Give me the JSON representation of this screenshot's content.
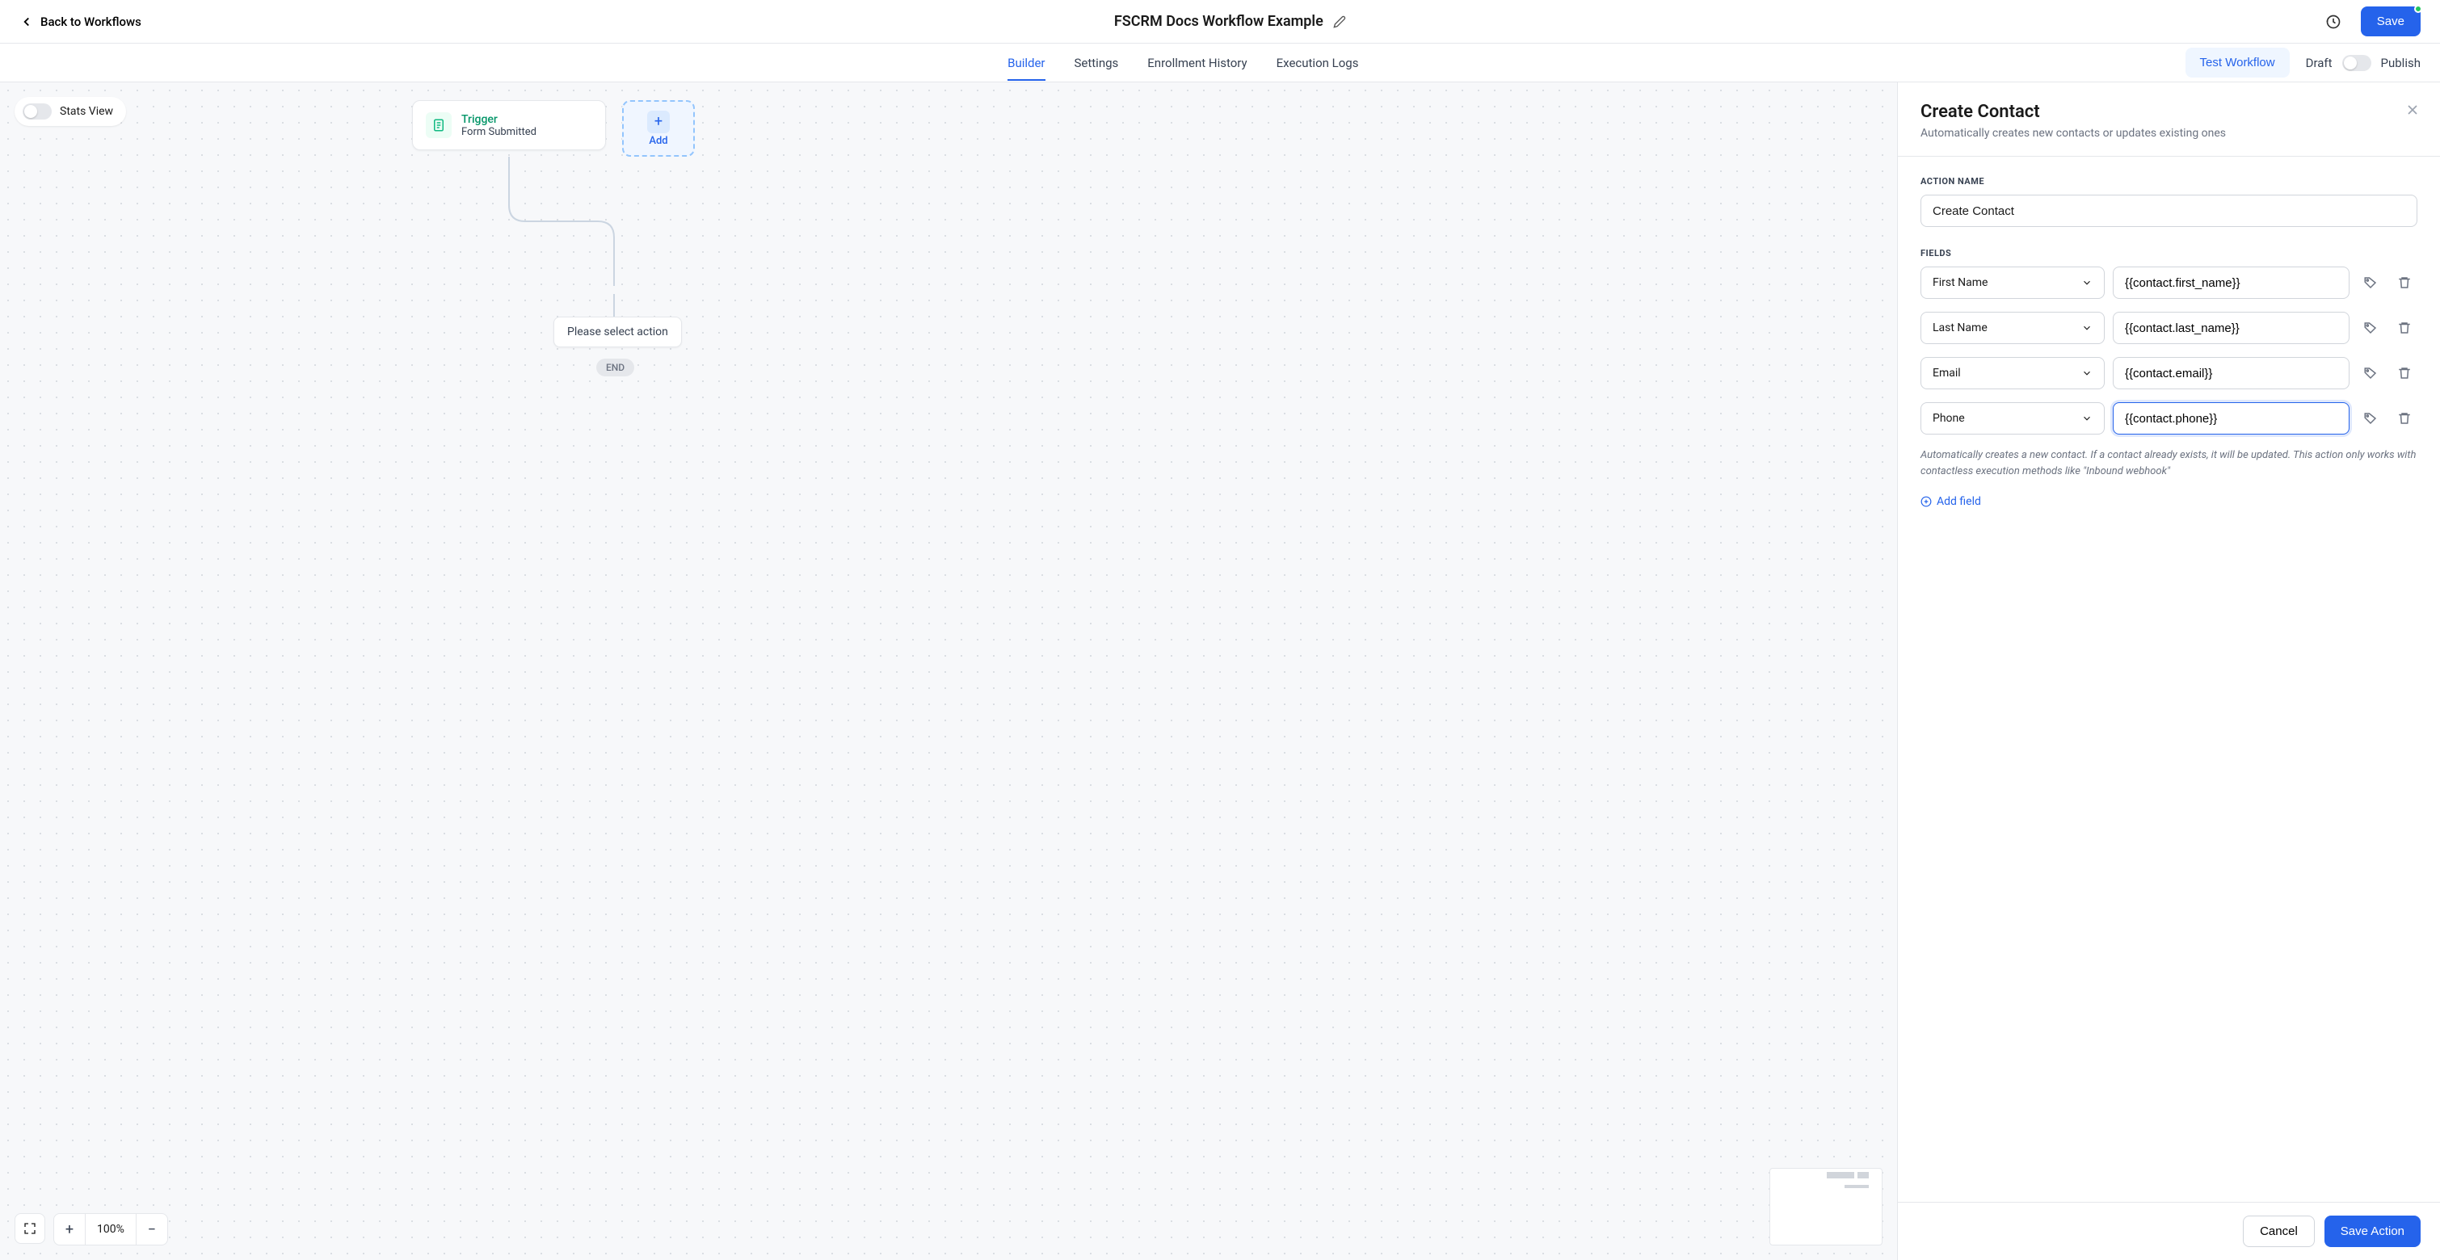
{
  "header": {
    "back_label": "Back to Workflows",
    "title": "FSCRM Docs Workflow Example",
    "save_label": "Save"
  },
  "subheader": {
    "tabs": [
      "Builder",
      "Settings",
      "Enrollment History",
      "Execution Logs"
    ],
    "active_tab": 0,
    "test_label": "Test Workflow",
    "draft_label": "Draft",
    "publish_label": "Publish"
  },
  "canvas": {
    "stats_label": "Stats View",
    "trigger": {
      "title": "Trigger",
      "subtitle": "Form Submitted"
    },
    "add_trigger_label": "Add",
    "select_action_label": "Please select action",
    "end_label": "END",
    "zoom_level": "100%"
  },
  "panel": {
    "title": "Create Contact",
    "subtitle": "Automatically creates new contacts or updates existing ones",
    "action_name_label": "ACTION NAME",
    "action_name_value": "Create Contact",
    "fields_label": "FIELDS",
    "fields": [
      {
        "name": "First Name",
        "value": "{{contact.first_name}}",
        "active": false
      },
      {
        "name": "Last Name",
        "value": "{{contact.last_name}}",
        "active": false
      },
      {
        "name": "Email",
        "value": "{{contact.email}}",
        "active": false
      },
      {
        "name": "Phone",
        "value": "{{contact.phone}}",
        "active": true
      }
    ],
    "hint": "Automatically creates a new contact. If a contact already exists, it will be updated. This action only works with contactless execution methods like \"Inbound webhook\"",
    "add_field_label": "Add field",
    "cancel_label": "Cancel",
    "save_action_label": "Save Action"
  }
}
